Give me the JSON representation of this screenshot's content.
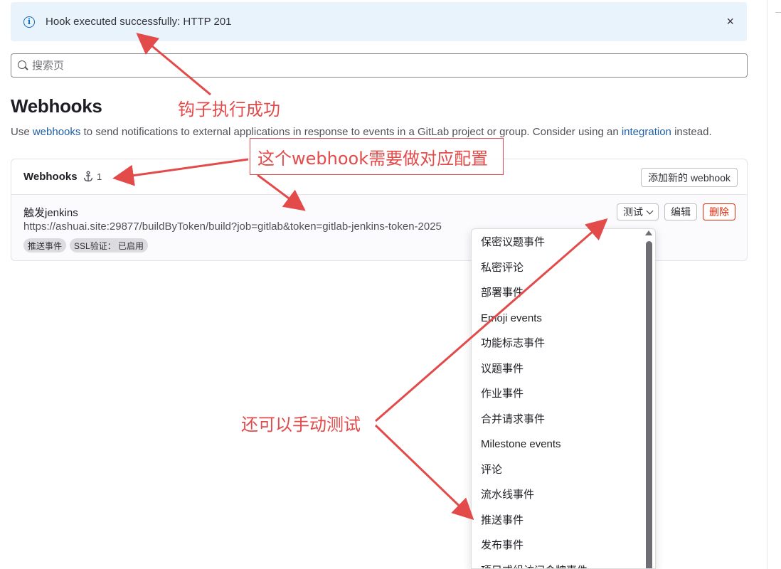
{
  "alert": {
    "message": "Hook executed successfully: HTTP 201",
    "close_glyph": "×",
    "info_glyph": "i"
  },
  "search": {
    "placeholder": "搜索页"
  },
  "page": {
    "title": "Webhooks",
    "description": {
      "prefix": "Use ",
      "link1": "webhooks",
      "middle": " to send notifications to external applications in response to events in a GitLab project or group. Consider using an ",
      "link2": "integration",
      "suffix": " instead."
    }
  },
  "card": {
    "title": "Webhooks",
    "count": "1",
    "add_button": "添加新的 webhook"
  },
  "hook": {
    "name": "触发jenkins",
    "url": "https://ashuai.site:29877/buildByToken/build?job=gitlab&token=gitlab-jenkins-token-2025",
    "badges": [
      "推送事件",
      "SSL验证： 已启用"
    ],
    "actions": {
      "test": "测试",
      "edit": "编辑",
      "delete": "删除"
    }
  },
  "dropdown": {
    "items": [
      "保密议题事件",
      "私密评论",
      "部署事件",
      "Emoji events",
      "功能标志事件",
      "议题事件",
      "作业事件",
      "合并请求事件",
      "Milestone events",
      "评论",
      "流水线事件",
      "推送事件",
      "发布事件",
      "项目或组访问令牌事件"
    ]
  },
  "annotations": {
    "success": "钩子执行成功",
    "config": "这个webhook需要做对应配置",
    "manual_test": "还可以手动测试"
  },
  "colors": {
    "alert_bg": "#e9f3fc",
    "link": "#1f5fa6",
    "danger": "#dd2b0e",
    "annotation": "#e34a4a"
  }
}
